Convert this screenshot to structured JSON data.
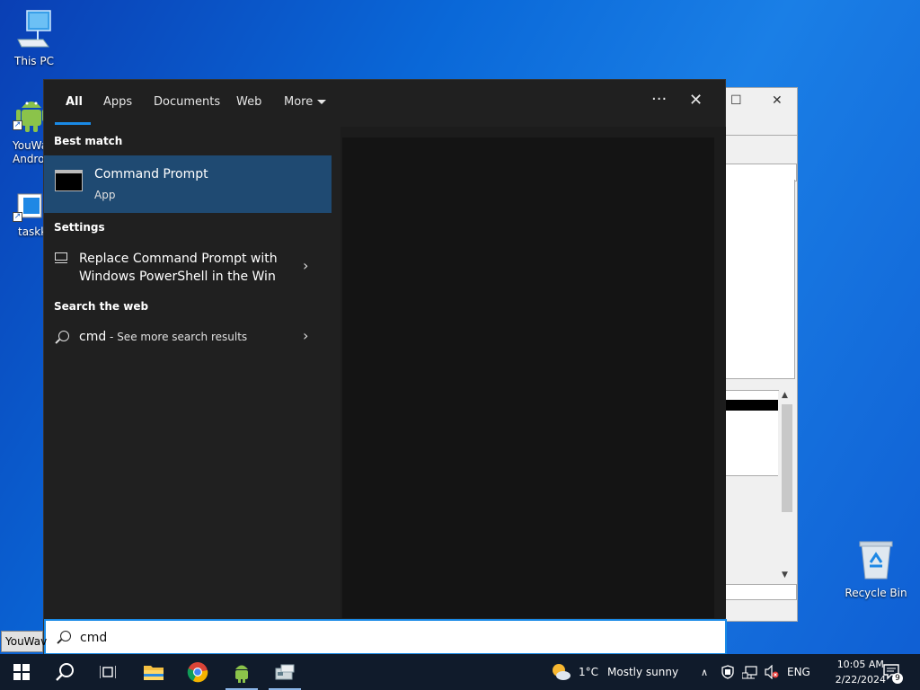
{
  "desktop": {
    "icons": [
      {
        "label": "This PC"
      },
      {
        "label": "YouWa\nAndro"
      },
      {
        "label": "taskk"
      },
      {
        "label": "Recycle Bin"
      }
    ]
  },
  "search": {
    "tabs": [
      {
        "label": "All"
      },
      {
        "label": "Apps"
      },
      {
        "label": "Documents"
      },
      {
        "label": "Web"
      },
      {
        "label": "More"
      }
    ],
    "more_glyph": "···",
    "close_glyph": "✕",
    "best_match_title": "Best match",
    "best_match": {
      "title": "Command Prompt",
      "subtitle": "App"
    },
    "settings_title": "Settings",
    "setting_item": "Replace Command Prompt with Windows PowerShell in the Win",
    "web_title": "Search the web",
    "web_item": {
      "query": "cmd",
      "suffix": " - See more search results"
    },
    "query": "cmd"
  },
  "partial_button": "YouWav",
  "taskbar": {
    "weather": {
      "temp": "1°C",
      "condition": "Mostly sunny"
    },
    "language": "ENG",
    "time": "10:05 AM",
    "date": "2/22/2024",
    "notification_count": "9"
  },
  "colors": {
    "accent": "#1a8ae6",
    "selection": "#1f4a72",
    "panel": "#202020"
  }
}
